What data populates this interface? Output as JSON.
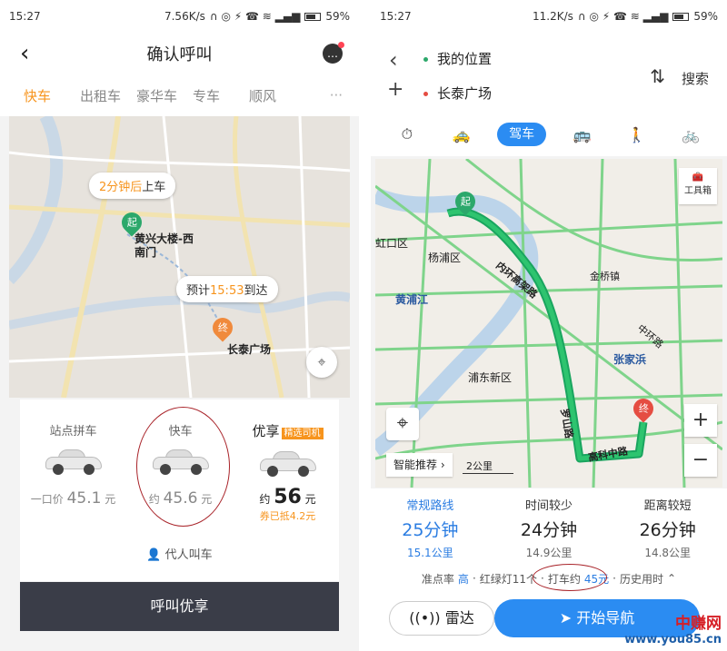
{
  "left": {
    "status": {
      "time": "15:27",
      "speed": "7.56K/s",
      "battery": "59%"
    },
    "title": "确认呼叫",
    "tabs": [
      {
        "label": "快车"
      },
      {
        "label": "出租车"
      },
      {
        "label": "豪华车"
      },
      {
        "label": "专车"
      },
      {
        "label": "顺风"
      }
    ],
    "more": "···",
    "map": {
      "pickup_bubble_pre": "2分钟后",
      "pickup_bubble_post": "上车",
      "start_pin": "起",
      "start_name": "黄兴大楼-西南门",
      "eta_pre": "预计",
      "eta_time": "15:53",
      "eta_post": "到达",
      "end_pin": "终",
      "end_name": "长泰广场"
    },
    "options": [
      {
        "name": "站点拼车",
        "price_prefix": "一口价",
        "price": "45.1",
        "unit": "元"
      },
      {
        "name": "快车",
        "price_prefix": "约",
        "price": "45.6",
        "unit": "元"
      },
      {
        "name": "优享",
        "badge": "精选司机",
        "price_prefix": "约",
        "price": "56",
        "unit": "元",
        "coupon": "券已抵4.2元"
      }
    ],
    "agent_call": "代人叫车",
    "call_button": "呼叫优享"
  },
  "right": {
    "status": {
      "time": "15:27",
      "speed": "11.2K/s",
      "battery": "59%"
    },
    "origin": "我的位置",
    "destination": "长泰广场",
    "search": "搜索",
    "modes": [
      {
        "label": "⏱"
      },
      {
        "label": "🚕"
      },
      {
        "label": "驾车"
      },
      {
        "label": "🚌"
      },
      {
        "label": "🚶"
      },
      {
        "label": "🚲"
      }
    ],
    "map": {
      "start_pin": "起",
      "end_pin": "终",
      "labels": [
        "虹口区",
        "杨浦区",
        "黄浦江",
        "浦东新区",
        "张家浜",
        "金桥镇",
        "内环高架路",
        "罗山路",
        "高科中路",
        "中环路"
      ],
      "toolbox": "工具箱",
      "smart": "智能推荐",
      "scale": "2公里"
    },
    "routes": [
      {
        "label": "常规路线",
        "time": "25分钟",
        "distance": "15.1公里"
      },
      {
        "label": "时间较少",
        "time": "24分钟",
        "distance": "14.9公里"
      },
      {
        "label": "距离较短",
        "time": "26分钟",
        "distance": "14.8公里"
      }
    ],
    "info": {
      "acc": "准点率",
      "acc_val": "高",
      "lights": "红绿灯11个",
      "taxi_pre": "打车约",
      "taxi_val": "45元",
      "history": "历史用时"
    },
    "radar": "雷达",
    "navigate": "开始导航"
  },
  "watermark": {
    "line1": "中赚网",
    "line2": "www.you85.cn"
  },
  "colors": {
    "accent_orange": "#f7941d",
    "accent_blue": "#2b8cf2",
    "route_green": "#1aa55f",
    "annotation": "#a9242a"
  }
}
